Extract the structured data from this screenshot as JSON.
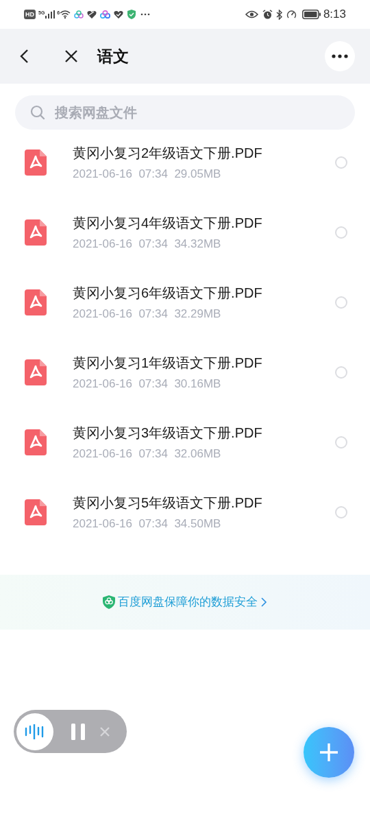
{
  "status_bar": {
    "hd": "HD",
    "network": "5G",
    "wifi_label": "6",
    "time": "8:13"
  },
  "header": {
    "title": "语文"
  },
  "search": {
    "placeholder": "搜索网盘文件"
  },
  "files": [
    {
      "name": "黄冈小复习2年级语文下册.PDF",
      "date": "2021-06-16",
      "time": "07:34",
      "size": "29.05MB",
      "selected": false
    },
    {
      "name": "黄冈小复习4年级语文下册.PDF",
      "date": "2021-06-16",
      "time": "07:34",
      "size": "34.32MB",
      "selected": false
    },
    {
      "name": "黄冈小复习6年级语文下册.PDF",
      "date": "2021-06-16",
      "time": "07:34",
      "size": "32.29MB",
      "selected": false
    },
    {
      "name": "黄冈小复习1年级语文下册.PDF",
      "date": "2021-06-16",
      "time": "07:34",
      "size": "30.16MB",
      "selected": false
    },
    {
      "name": "黄冈小复习3年级语文下册.PDF",
      "date": "2021-06-16",
      "time": "07:34",
      "size": "32.06MB",
      "selected": false
    },
    {
      "name": "黄冈小复习5年级语文下册.PDF",
      "date": "2021-06-16",
      "time": "07:34",
      "size": "34.50MB",
      "selected": false
    }
  ],
  "security_notice": {
    "text": "百度网盘保障你的数据安全"
  }
}
